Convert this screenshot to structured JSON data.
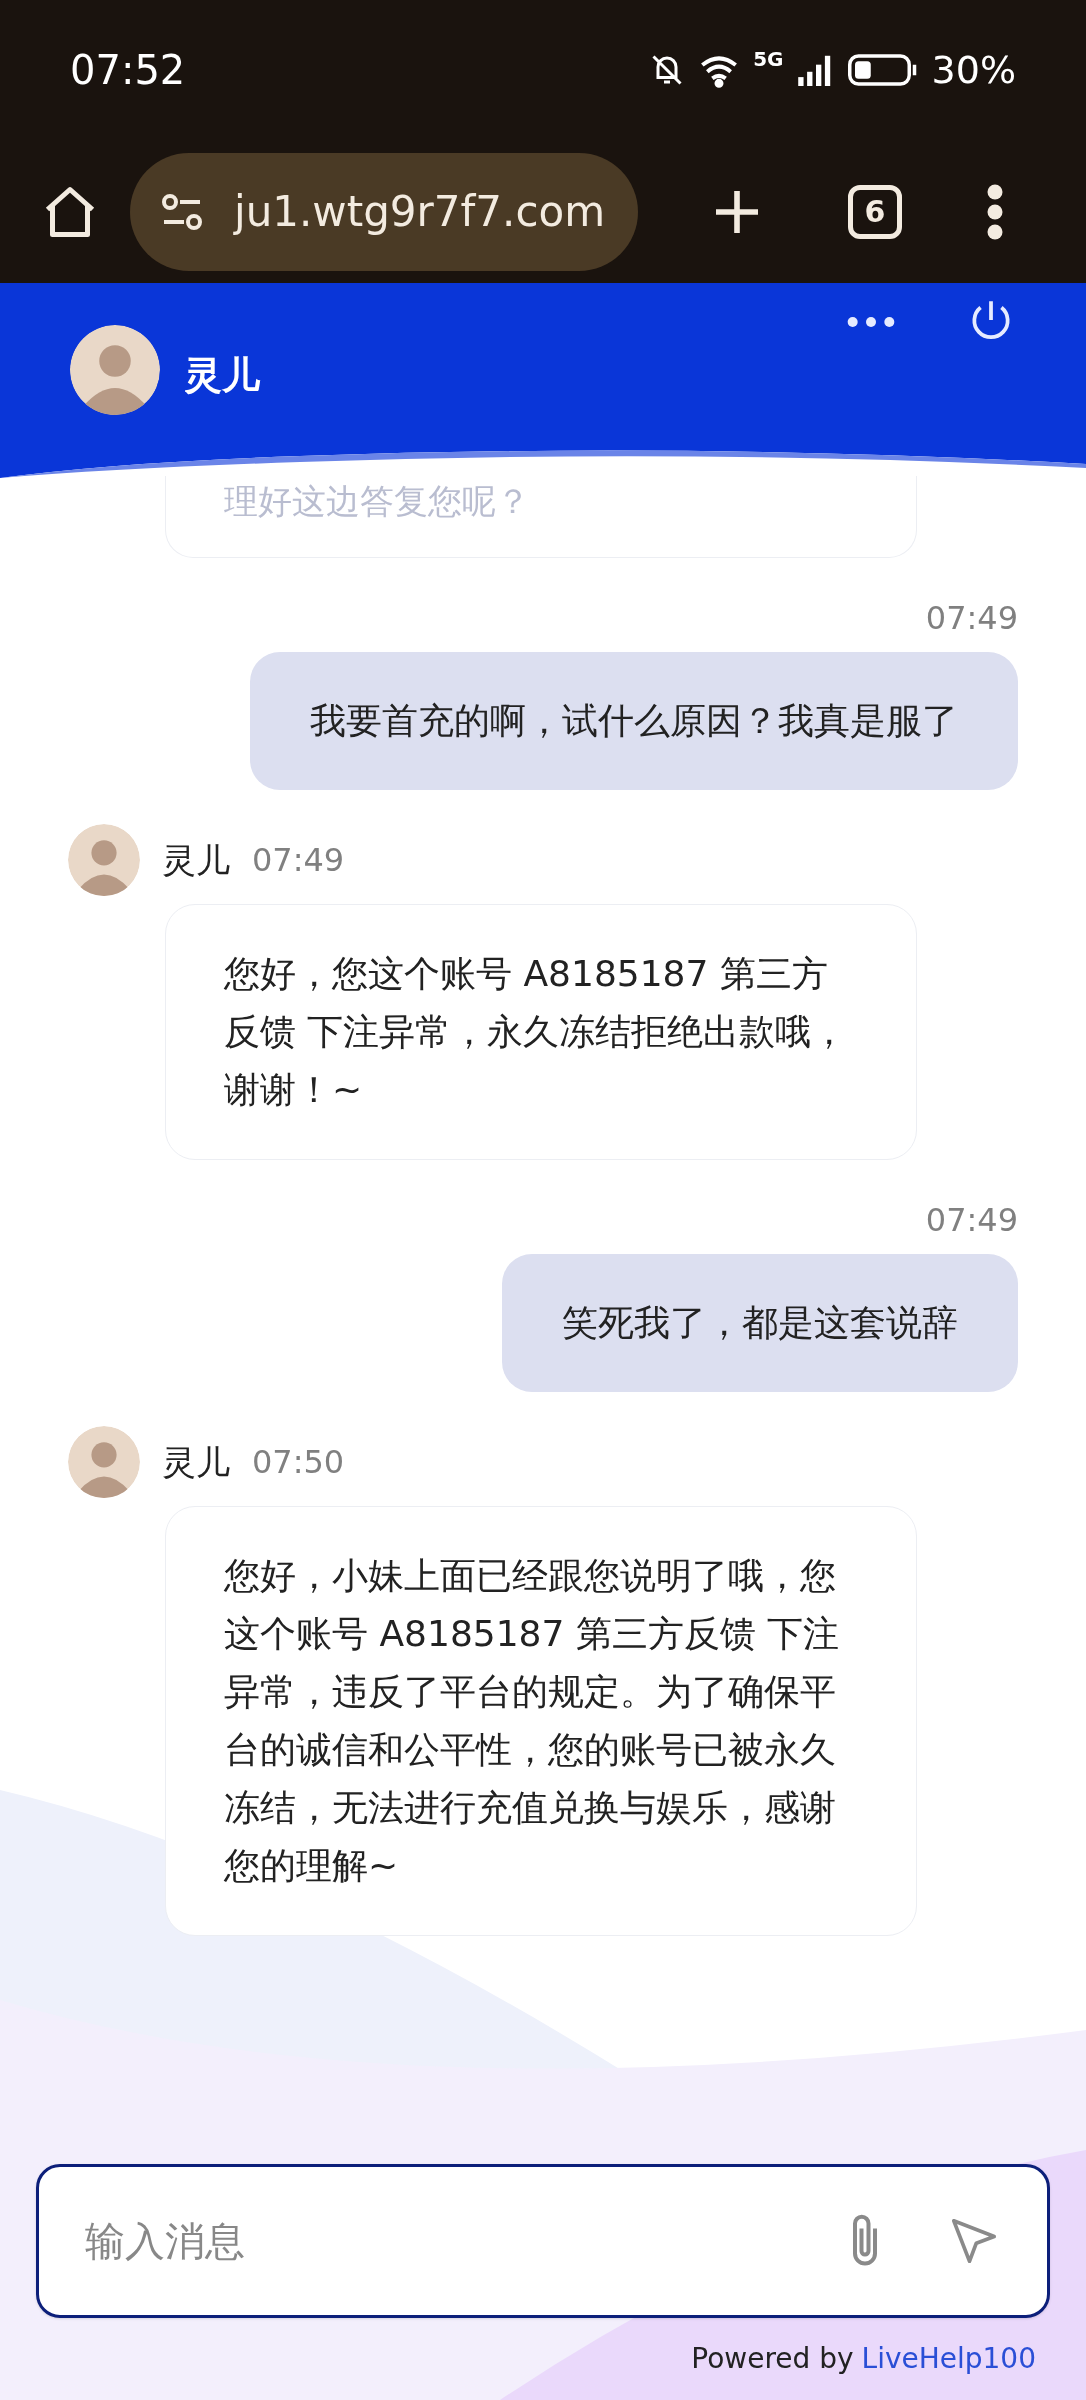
{
  "status_bar": {
    "time": "07:52",
    "network": "5G",
    "battery": "30%"
  },
  "browser": {
    "url": "ju1.wtg9r7f7.com",
    "tab_count": "6"
  },
  "chat_header": {
    "agent_name": "灵儿"
  },
  "messages": [
    {
      "kind": "partial",
      "text": "理好这边答复您呢？"
    },
    {
      "kind": "sent",
      "time": "07:49",
      "text": "我要首充的啊，试什么原因？我真是服了"
    },
    {
      "kind": "received",
      "sender": "灵儿",
      "time": "07:49",
      "text": "您好，您这个账号 A8185187 第三方反馈 下注异常，永久冻结拒绝出款哦，谢谢！~"
    },
    {
      "kind": "sent",
      "time": "07:49",
      "text": "笑死我了，都是这套说辞"
    },
    {
      "kind": "received",
      "sender": "灵儿",
      "time": "07:50",
      "text": "您好，小妹上面已经跟您说明了哦，您这个账号 A8185187 第三方反馈 下注异常，违反了平台的规定。为了确保平台的诚信和公平性，您的账号已被永久冻结，无法进行充值兑换与娱乐，感谢您的理解~"
    }
  ],
  "composer": {
    "placeholder": "输入消息"
  },
  "footer": {
    "prefix": "Powered by",
    "link": "LiveHelp100"
  }
}
